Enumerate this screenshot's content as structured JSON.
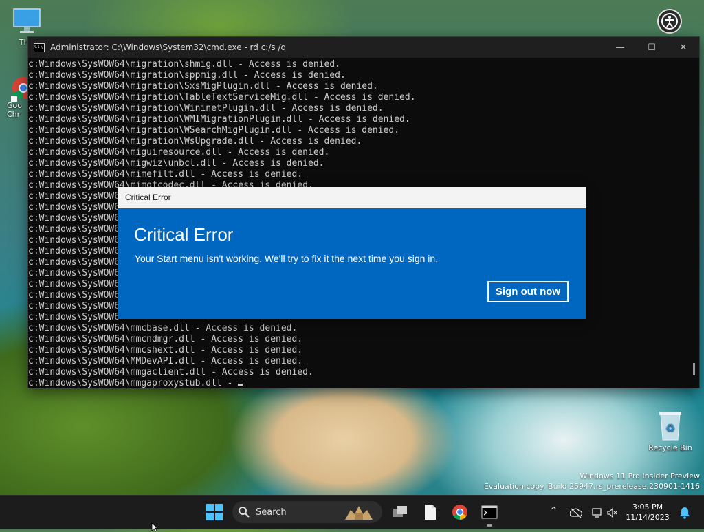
{
  "desktop": {
    "icons": [
      {
        "label": "This",
        "name": "this-pc"
      },
      {
        "label": "Goo\nChr",
        "name": "google-chrome"
      },
      {
        "label": "Recycle Bin",
        "name": "recycle-bin"
      }
    ],
    "watermark_line1": "Windows 11 Pro Insider Preview",
    "watermark_line2": "Evaluation copy. Build 25947.rs_prerelease.230901-1416"
  },
  "cmd_window": {
    "title": "Administrator: C:\\Windows\\System32\\cmd.exe - rd  c:/s /q",
    "title_icon_text": "C:\\",
    "controls": {
      "minimize": "—",
      "maximize": "☐",
      "close": "✕"
    },
    "lines": [
      "c:Windows\\SysWOW64\\migration\\shmig.dll - Access is denied.",
      "c:Windows\\SysWOW64\\migration\\sppmig.dll - Access is denied.",
      "c:Windows\\SysWOW64\\migration\\SxsMigPlugin.dll - Access is denied.",
      "c:Windows\\SysWOW64\\migration\\TableTextServiceMig.dll - Access is denied.",
      "c:Windows\\SysWOW64\\migration\\WininetPlugin.dll - Access is denied.",
      "c:Windows\\SysWOW64\\migration\\WMIMigrationPlugin.dll - Access is denied.",
      "c:Windows\\SysWOW64\\migration\\WSearchMigPlugin.dll - Access is denied.",
      "c:Windows\\SysWOW64\\migration\\WsUpgrade.dll - Access is denied.",
      "c:Windows\\SysWOW64\\miguiresource.dll - Access is denied.",
      "c:Windows\\SysWOW64\\migwiz\\unbcl.dll - Access is denied.",
      "c:Windows\\SysWOW64\\mimefilt.dll - Access is denied.",
      "c:Windows\\SysWOW64\\mimofcodec.dll - Access is denied.",
      "c:Windows\\SysWOW6",
      "c:Windows\\SysWOW6",
      "c:Windows\\SysWOW6",
      "c:Windows\\SysWOW6",
      "c:Windows\\SysWOW6",
      "c:Windows\\SysWOW6",
      "c:Windows\\SysWOW6",
      "c:Windows\\SysWOW6",
      "c:Windows\\SysWOW6",
      "c:Windows\\SysWOW6",
      "c:Windows\\SysWOW6",
      "c:Windows\\SysWOW6",
      "c:Windows\\SysWOW64\\mmcbase.dll - Access is denied.",
      "c:Windows\\SysWOW64\\mmcndmgr.dll - Access is denied.",
      "c:Windows\\SysWOW64\\mmcshext.dll - Access is denied.",
      "c:Windows\\SysWOW64\\MMDevAPI.dll - Access is denied.",
      "c:Windows\\SysWOW64\\mmgaclient.dll - Access is denied.",
      "c:Windows\\SysWOW64\\mmgaproxystub.dll - "
    ]
  },
  "dialog": {
    "titlebar": "Critical Error",
    "heading": "Critical Error",
    "message": "Your Start menu isn't working. We'll try to fix it the next time you sign in.",
    "button": "Sign out now",
    "accent": "#0067c0"
  },
  "taskbar": {
    "search_label": "Search",
    "time": "3:05 PM",
    "date": "11/14/2023",
    "tray_chevron": "^"
  }
}
